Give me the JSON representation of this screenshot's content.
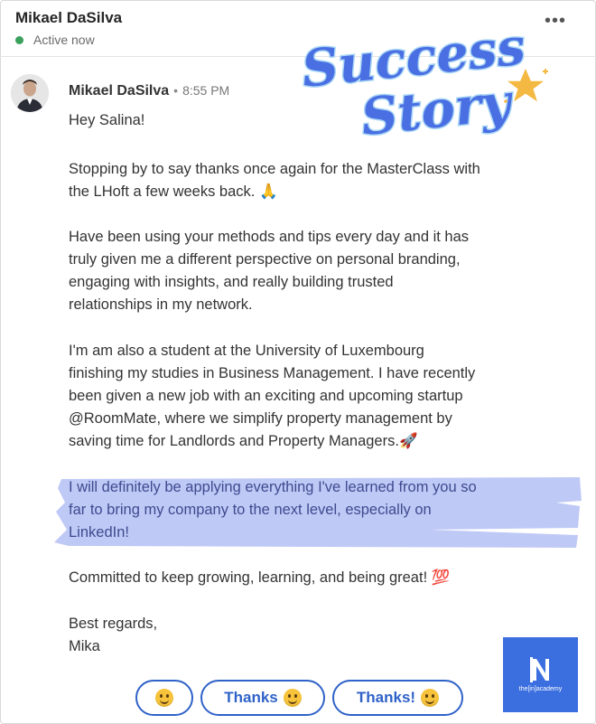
{
  "header": {
    "name": "Mikael DaSilva",
    "status": "Active now",
    "more_icon": "more-horizontal-icon"
  },
  "badge": {
    "line1": "Success",
    "line2": "Story",
    "colors": {
      "fill": "#4a6fe3",
      "outline": "#a9d6f5",
      "star": "#f4b942"
    }
  },
  "message": {
    "sender": "Mikael DaSilva",
    "separator": "•",
    "time": "8:55 PM",
    "greeting": "Hey Salina!",
    "p1_line1": "Stopping by to say thanks once again for the MasterClass with",
    "p1_line2": "the LHoft a few weeks back. 🙏",
    "p2_line1": "Have been using your methods and tips every day and it has",
    "p2_line2": "truly given me a different perspective on personal branding,",
    "p2_line3": "engaging with insights, and really building trusted",
    "p2_line4": "relationships in my network.",
    "p3_line1": "I'm am also a student at the University of Luxembourg",
    "p3_line2": "finishing my studies in Business Management. I have recently",
    "p3_line3": "been given a new job with an exciting and upcoming startup",
    "p3_line4": "@RoomMate, where we simplify property management by",
    "p3_line5": "saving time for Landlords and Property Managers.🚀",
    "p4_line1": "I will definitely be applying everything I've learned from you so",
    "p4_line2": "far to bring my company to the next level, especially on",
    "p4_line3": "LinkedIn!",
    "p5": "Committed to keep growing, learning, and being great! 💯",
    "signoff": "Best regards,",
    "signature": "Mika"
  },
  "quick_replies": {
    "reply2": "Thanks",
    "reply3": "Thanks!"
  },
  "logo": {
    "mark": "N",
    "text": "the[in]academy",
    "color": "#3b6fe0"
  },
  "colors": {
    "highlight": "#b8c3f5",
    "button": "#2f62c8",
    "online": "#3aa15d"
  }
}
